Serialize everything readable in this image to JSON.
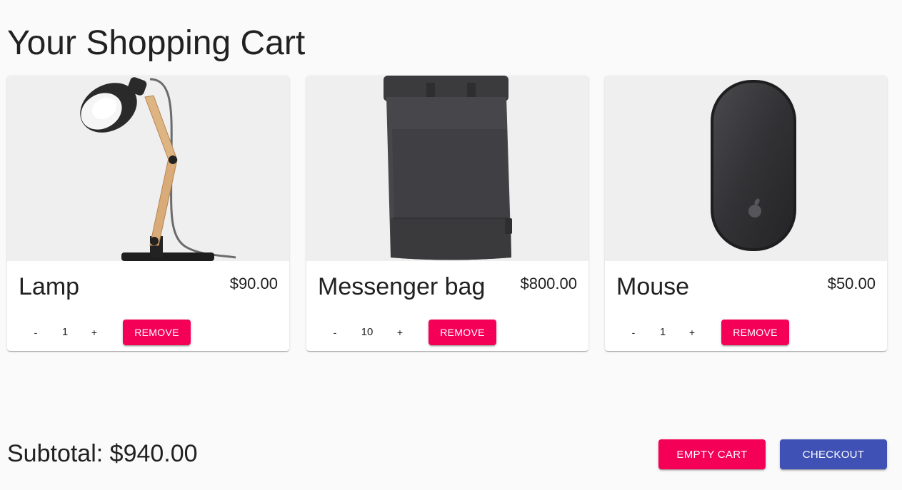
{
  "page": {
    "title": "Your Shopping Cart"
  },
  "cart": {
    "items": [
      {
        "name": "Lamp",
        "price": "$90.00",
        "quantity": "1",
        "minus_label": "-",
        "plus_label": "+",
        "remove_label": "REMOVE",
        "image_icon": "desk-lamp-image"
      },
      {
        "name": "Messenger bag",
        "price": "$800.00",
        "quantity": "10",
        "minus_label": "-",
        "plus_label": "+",
        "remove_label": "REMOVE",
        "image_icon": "backpack-image"
      },
      {
        "name": "Mouse",
        "price": "$50.00",
        "quantity": "1",
        "minus_label": "-",
        "plus_label": "+",
        "remove_label": "REMOVE",
        "image_icon": "mouse-image"
      }
    ]
  },
  "footer": {
    "subtotal": "Subtotal: $940.00",
    "empty_cart_label": "EMPTY CART",
    "checkout_label": "CHECKOUT"
  },
  "colors": {
    "accent_pink": "#f50057",
    "primary_indigo": "#3f51b5",
    "background": "#fafafa",
    "media_background": "#efefef"
  }
}
